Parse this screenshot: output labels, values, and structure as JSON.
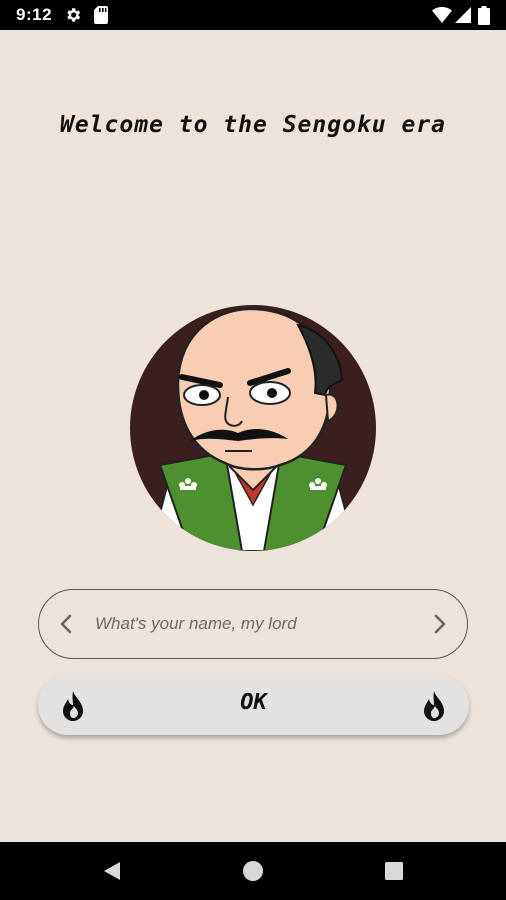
{
  "status_bar": {
    "time": "9:12",
    "icons": [
      "settings-gear-icon",
      "sd-card-icon",
      "wifi-icon",
      "signal-icon",
      "battery-icon"
    ]
  },
  "main": {
    "welcome_title": "Welcome to the Sengoku era",
    "portrait": "samurai-lord-avatar",
    "name_input": {
      "placeholder": "What's your name, my lord",
      "value": ""
    },
    "ok_button": {
      "label": "OK"
    }
  },
  "nav_bar": {
    "buttons": [
      "back-icon",
      "home-icon",
      "recents-icon"
    ]
  },
  "colors": {
    "background": "#ede3da",
    "button_bg": "#e4e2e0",
    "robe_green": "#4e8f2f",
    "portrait_bg": "#3a1f1e"
  }
}
